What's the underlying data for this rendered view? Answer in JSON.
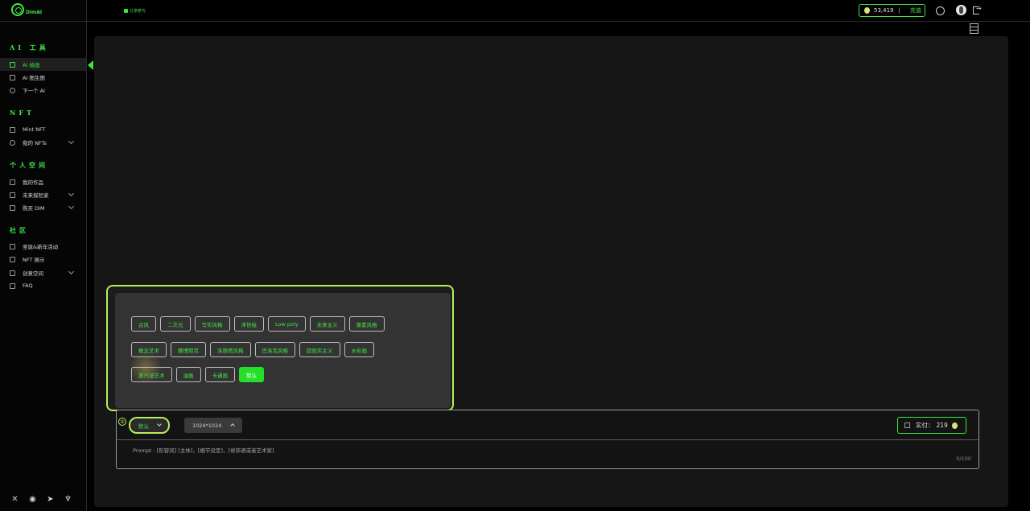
{
  "brand": {
    "name": "DimAI"
  },
  "header": {
    "share_label": "分享参与",
    "balance": "53,419",
    "balance_separator": "|",
    "recharge_label": "充值"
  },
  "sidebar": {
    "sections": [
      {
        "title": "AI 工具",
        "items": [
          {
            "label": "AI 绘画"
          },
          {
            "label": "AI 图生图"
          },
          {
            "label": "下一个 AI"
          }
        ]
      },
      {
        "title": "NFT",
        "items": [
          {
            "label": "Mint NFT"
          },
          {
            "label": "我的 NFTs"
          }
        ]
      },
      {
        "title": "个人空间",
        "items": [
          {
            "label": "我的作品"
          },
          {
            "label": "未来探险家"
          },
          {
            "label": "购买 DIM"
          }
        ]
      },
      {
        "title": "社区",
        "items": [
          {
            "label": "圣诞&新年活动"
          },
          {
            "label": "NFT 展示"
          },
          {
            "label": "创意空间"
          },
          {
            "label": "FAQ"
          }
        ]
      }
    ],
    "social": [
      "X",
      "Discord",
      "Telegram",
      "Mic"
    ]
  },
  "styles": {
    "row1": [
      "古风",
      "二次元",
      "写实风格",
      "浮世绘",
      "Low poly",
      "未来主义",
      "像素风格"
    ],
    "row2": [
      "概念艺术",
      "赛博朋克",
      "洛丽塔风格",
      "巴洛克风格",
      "超现实主义",
      "水彩画"
    ],
    "row3": [
      "蒸汽波艺术",
      "油画",
      "卡通画",
      "默认"
    ],
    "selected": "默认"
  },
  "prompt": {
    "step_number": "③",
    "style_value": "默认",
    "size_value": "1024*1024",
    "payment_label": "实付：",
    "payment_amount": "219",
    "placeholder": "Prompt : [形容词] [主体]，[细节设定]，[修饰语或者艺术家]",
    "counter": "0/100"
  }
}
